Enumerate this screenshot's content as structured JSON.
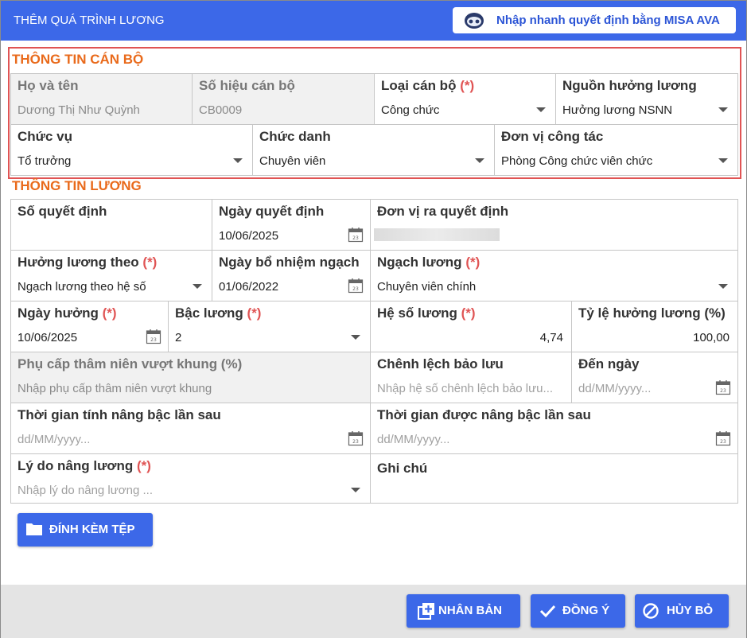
{
  "dialog": {
    "title": "THÊM QUÁ TRÌNH LƯƠNG",
    "ava_button_label": "Nhập nhanh quyết định bằng MISA AVA"
  },
  "can_bo": {
    "section_title": "THÔNG TIN CÁN BỘ",
    "ho_ten": {
      "label": "Họ và tên",
      "value": "Dương Thị Như Quỳnh"
    },
    "so_hieu": {
      "label": "Số hiệu cán bộ",
      "value": "CB0009"
    },
    "loai_can_bo": {
      "label": "Loại cán bộ",
      "required": "(*)",
      "value": "Công chức"
    },
    "nguon_huong_luong": {
      "label": "Nguồn hưởng lương",
      "value": "Hưởng lương NSNN"
    },
    "chuc_vu": {
      "label": "Chức vụ",
      "value": "Tổ trưởng"
    },
    "chuc_danh": {
      "label": "Chức danh",
      "value": "Chuyên viên"
    },
    "don_vi_cong_tac": {
      "label": "Đơn vị công tác",
      "value": "Phòng Công chức viên chức"
    }
  },
  "luong": {
    "section_title": "THÔNG TIN LƯƠNG",
    "so_quyet_dinh": {
      "label": "Số quyết định",
      "value": ""
    },
    "ngay_quyet_dinh": {
      "label": "Ngày quyết định",
      "value": "10/06/2025"
    },
    "don_vi_ra_qd": {
      "label": "Đơn vị ra quyết định"
    },
    "huong_luong_theo": {
      "label": "Hưởng lương theo",
      "required": "(*)",
      "value": "Ngạch lương theo hệ số"
    },
    "ngay_bo_nhiem": {
      "label": "Ngày bổ nhiệm ngạch",
      "value": "01/06/2022"
    },
    "ngach_luong": {
      "label": "Ngạch lương",
      "required": "(*)",
      "value": "Chuyên viên chính"
    },
    "ngay_huong": {
      "label": "Ngày hưởng",
      "required": "(*)",
      "value": "10/06/2025"
    },
    "bac_luong": {
      "label": "Bậc lương",
      "required": "(*)",
      "value": "2"
    },
    "he_so_luong": {
      "label": "Hệ số lương",
      "required": "(*)",
      "value": "4,74"
    },
    "ty_le": {
      "label": "Tỷ lệ hưởng lương (%)",
      "value": "100,00"
    },
    "phu_cap": {
      "label": "Phụ cấp thâm niên vượt khung (%)",
      "placeholder": "Nhập phụ cấp thâm niên vượt khung"
    },
    "chenh_lech": {
      "label": "Chênh lệch bảo lưu",
      "placeholder": "Nhập hệ số chênh lệch bảo lưu..."
    },
    "den_ngay": {
      "label": "Đến ngày",
      "placeholder": "dd/MM/yyyy..."
    },
    "tg_nang_bac": {
      "label": "Thời gian tính nâng bậc lần sau",
      "placeholder": "dd/MM/yyyy..."
    },
    "tg_duoc_nang": {
      "label": "Thời gian được nâng bậc lần sau",
      "placeholder": "dd/MM/yyyy..."
    },
    "ly_do": {
      "label": "Lý do nâng lương",
      "required": "(*)",
      "placeholder": "Nhập lý do nâng lương ..."
    },
    "ghi_chu": {
      "label": "Ghi chú"
    }
  },
  "attach_label": "ĐÍNH KÈM TỆP",
  "footer": {
    "duplicate_label": "NHÂN BẢN",
    "ok_label": "ĐỒNG Ý",
    "cancel_label": "HỦY BỎ"
  },
  "calendar_day": "23",
  "colors": {
    "primary": "#3c68e8",
    "section": "#e96a1b",
    "required": "#e05454"
  }
}
